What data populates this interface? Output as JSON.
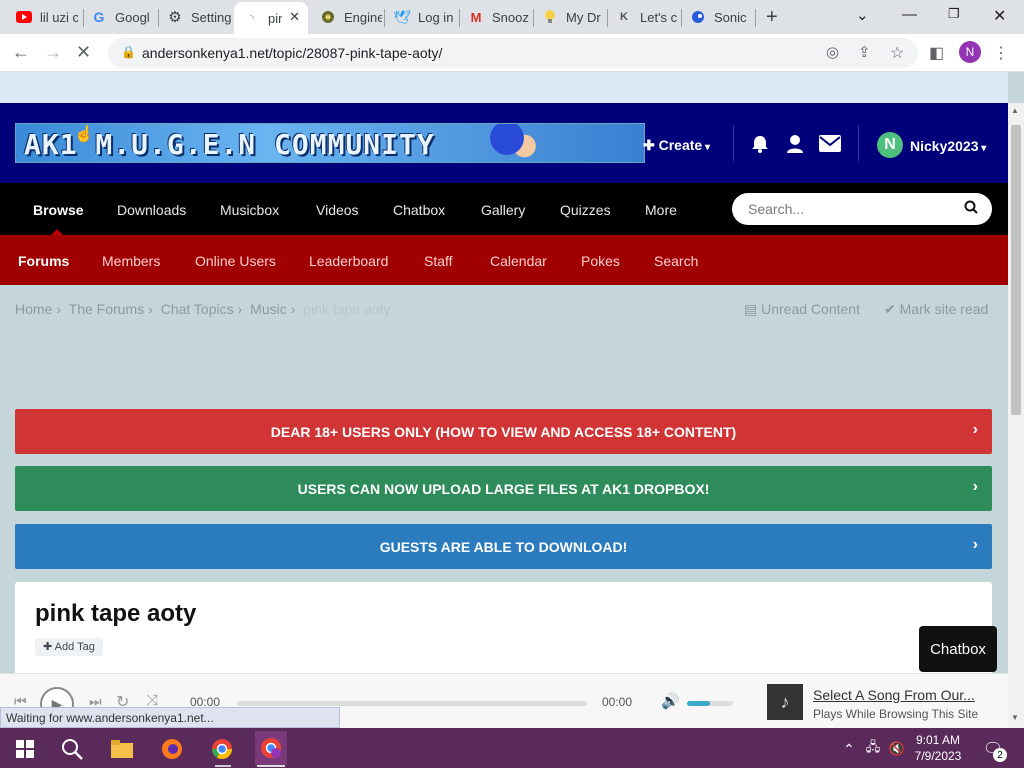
{
  "browser": {
    "tabs": [
      {
        "label": "lil uzi c",
        "icon": "youtube-icon"
      },
      {
        "label": "Googl",
        "icon": "google-icon"
      },
      {
        "label": "Setting",
        "icon": "gear-icon"
      },
      {
        "label": "pir",
        "icon": "page-icon",
        "active": true
      },
      {
        "label": "Engine",
        "icon": "engine-icon"
      },
      {
        "label": "Log in",
        "icon": "twitter-icon"
      },
      {
        "label": "Snooz",
        "icon": "gmail-icon"
      },
      {
        "label": "My Dr",
        "icon": "bulb-icon"
      },
      {
        "label": "Let's c",
        "icon": "site-icon"
      },
      {
        "label": "Sonic",
        "icon": "sonic-icon"
      }
    ],
    "new_tab": "+",
    "url": "andersonkenya1.net/topic/28087-pink-tape-aoty/",
    "profile_initial": "N"
  },
  "site": {
    "logo_text": "AK1 M.U.G.E.N COMMUNITY",
    "create_label": "Create",
    "username": "Nicky2023",
    "user_initial": "N",
    "main_nav": [
      "Browse",
      "Downloads",
      "Musicbox",
      "Videos",
      "Chatbox",
      "Gallery",
      "Quizzes",
      "More"
    ],
    "search_placeholder": "Search...",
    "sub_nav": [
      "Forums",
      "Members",
      "Online Users",
      "Leaderboard",
      "Staff",
      "Calendar",
      "Pokes",
      "Search"
    ],
    "breadcrumbs": [
      "Home",
      "The Forums",
      "Chat Topics",
      "Music",
      "pink tape aoty"
    ],
    "unread_content": "Unread Content",
    "mark_site_read": "Mark site read",
    "announcements": [
      {
        "text": "DEAR 18+ USERS ONLY (HOW TO VIEW AND ACCESS 18+ CONTENT)",
        "color": "#d03434"
      },
      {
        "text": "USERS CAN NOW UPLOAD LARGE FILES AT AK1 DROPBOX!",
        "color": "#2e8b5a"
      },
      {
        "text": "GUESTS ARE ABLE TO DOWNLOAD!",
        "color": "#2b7bbf"
      }
    ],
    "topic_title": "pink tape aoty",
    "add_tag": "Add Tag",
    "chatbox_label": "Chatbox"
  },
  "player": {
    "time_current": "00:00",
    "time_total": "00:00",
    "volume_level": 0.5,
    "song_title": "Select A Song From Our...",
    "song_subtitle": "Plays While Browsing This Site"
  },
  "status_text": "Waiting for www.andersonkenya1.net...",
  "taskbar": {
    "time": "9:01 AM",
    "date": "7/9/2023",
    "notification_count": "2"
  }
}
